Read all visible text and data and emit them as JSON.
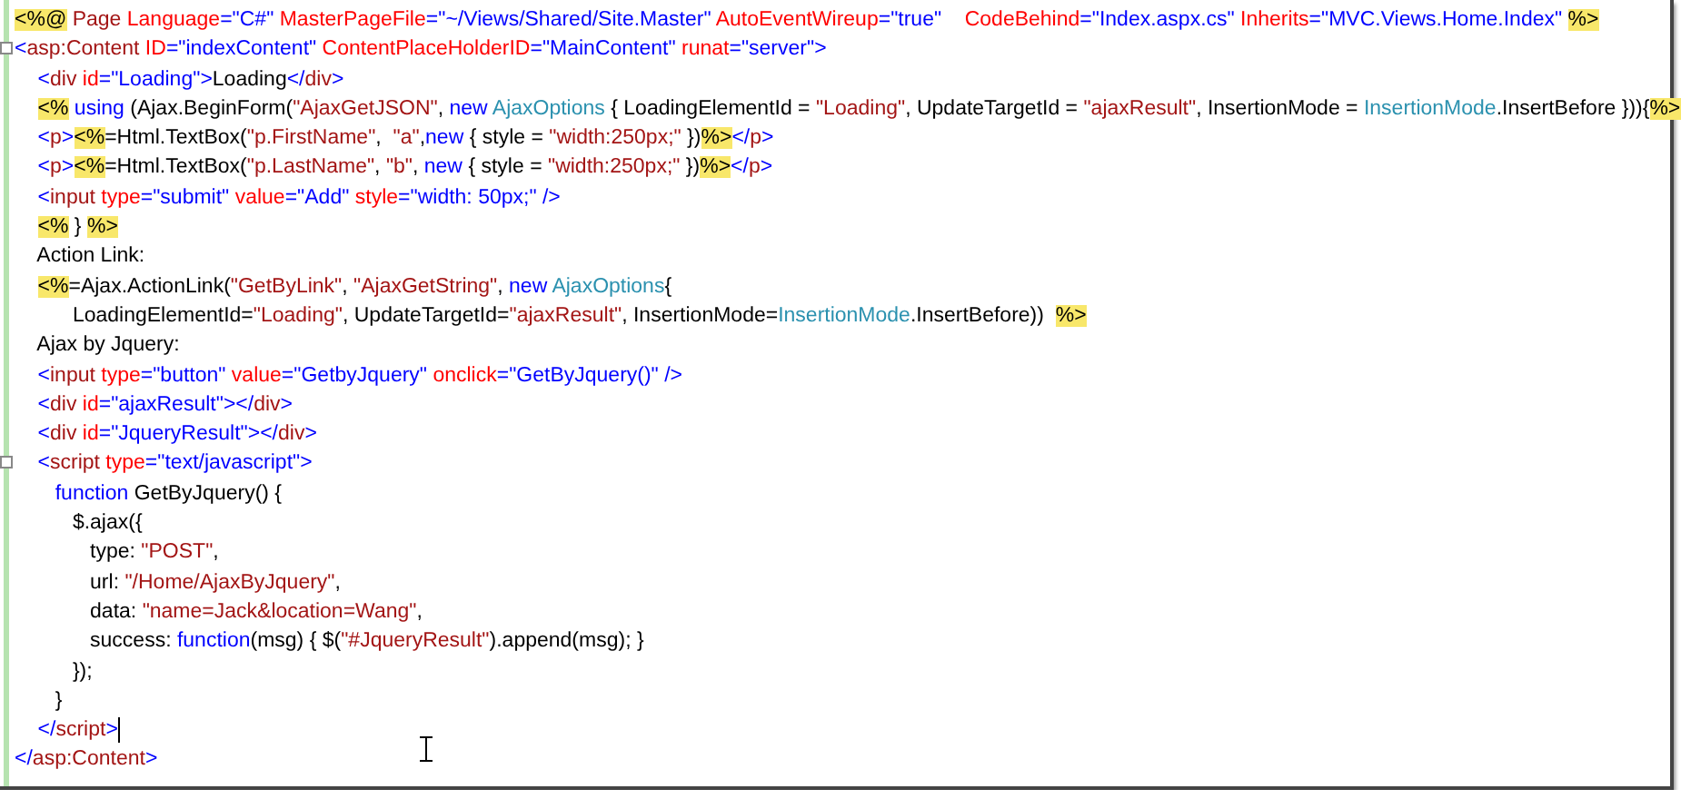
{
  "editor": {
    "lines": [
      {
        "collapsible": false,
        "caret": false,
        "tokens": [
          {
            "kind": "delim",
            "text": "<%@"
          },
          {
            "kind": "tag",
            "text": " Page"
          },
          {
            "kind": "attr",
            "text": " Language"
          },
          {
            "kind": "punct",
            "text": "="
          },
          {
            "kind": "value",
            "text": "\"C#\""
          },
          {
            "kind": "attr",
            "text": " MasterPageFile"
          },
          {
            "kind": "punct",
            "text": "="
          },
          {
            "kind": "value",
            "text": "\"~/Views/Shared/Site.Master\""
          },
          {
            "kind": "attr",
            "text": " AutoEventWireup"
          },
          {
            "kind": "punct",
            "text": "="
          },
          {
            "kind": "value",
            "text": "\"true\""
          },
          {
            "kind": "attr",
            "text": "    CodeBehind"
          },
          {
            "kind": "punct",
            "text": "="
          },
          {
            "kind": "value",
            "text": "\"Index.aspx.cs\""
          },
          {
            "kind": "attr",
            "text": " Inherits"
          },
          {
            "kind": "punct",
            "text": "="
          },
          {
            "kind": "value",
            "text": "\"MVC.Views.Home.Index\""
          },
          {
            "kind": "delim",
            "text": " %>"
          }
        ]
      },
      {
        "collapsible": true,
        "caret": false,
        "tokens": [
          {
            "kind": "punct",
            "text": "<"
          },
          {
            "kind": "tag",
            "text": "asp:Content"
          },
          {
            "kind": "attr",
            "text": " ID"
          },
          {
            "kind": "punct",
            "text": "="
          },
          {
            "kind": "value",
            "text": "\"indexContent\""
          },
          {
            "kind": "attr",
            "text": " ContentPlaceHolderID"
          },
          {
            "kind": "punct",
            "text": "="
          },
          {
            "kind": "value",
            "text": "\"MainContent\""
          },
          {
            "kind": "attr",
            "text": " runat"
          },
          {
            "kind": "punct",
            "text": "="
          },
          {
            "kind": "value",
            "text": "\"server\""
          },
          {
            "kind": "punct",
            "text": ">"
          }
        ]
      },
      {
        "collapsible": false,
        "caret": false,
        "tokens": [
          {
            "kind": "punct",
            "text": "    <"
          },
          {
            "kind": "tag",
            "text": "div"
          },
          {
            "kind": "attr",
            "text": " id"
          },
          {
            "kind": "punct",
            "text": "="
          },
          {
            "kind": "value",
            "text": "\"Loading\""
          },
          {
            "kind": "punct",
            "text": ">"
          },
          {
            "kind": "text",
            "text": "Loading"
          },
          {
            "kind": "punct",
            "text": "</"
          },
          {
            "kind": "tag",
            "text": "div"
          },
          {
            "kind": "punct",
            "text": ">"
          }
        ]
      },
      {
        "collapsible": false,
        "caret": false,
        "tokens": [
          {
            "kind": "delim",
            "text": "    <%"
          },
          {
            "kind": "keyword",
            "text": " using"
          },
          {
            "kind": "text",
            "text": " (Ajax.BeginForm("
          },
          {
            "kind": "string",
            "text": "\"AjaxGetJSON\""
          },
          {
            "kind": "text",
            "text": ", "
          },
          {
            "kind": "keyword",
            "text": "new"
          },
          {
            "kind": "type",
            "text": " AjaxOptions"
          },
          {
            "kind": "text",
            "text": " { LoadingElementId = "
          },
          {
            "kind": "string",
            "text": "\"Loading\""
          },
          {
            "kind": "text",
            "text": ", UpdateTargetId = "
          },
          {
            "kind": "string",
            "text": "\"ajaxResult\""
          },
          {
            "kind": "text",
            "text": ", InsertionMode = "
          },
          {
            "kind": "type",
            "text": "InsertionMode"
          },
          {
            "kind": "text",
            "text": ".InsertBefore })){"
          },
          {
            "kind": "delim",
            "text": "%>"
          }
        ]
      },
      {
        "collapsible": false,
        "caret": false,
        "tokens": [
          {
            "kind": "punct",
            "text": "    <"
          },
          {
            "kind": "tag",
            "text": "p"
          },
          {
            "kind": "punct",
            "text": ">"
          },
          {
            "kind": "delim",
            "text": "<%"
          },
          {
            "kind": "text",
            "text": "=Html.TextBox("
          },
          {
            "kind": "string",
            "text": "\"p.FirstName\""
          },
          {
            "kind": "text",
            "text": ",  "
          },
          {
            "kind": "string",
            "text": "\"a\""
          },
          {
            "kind": "text",
            "text": ","
          },
          {
            "kind": "keyword",
            "text": "new"
          },
          {
            "kind": "text",
            "text": " { style = "
          },
          {
            "kind": "string",
            "text": "\"width:250px;\""
          },
          {
            "kind": "text",
            "text": " })"
          },
          {
            "kind": "delim",
            "text": "%>"
          },
          {
            "kind": "punct",
            "text": "</"
          },
          {
            "kind": "tag",
            "text": "p"
          },
          {
            "kind": "punct",
            "text": ">"
          }
        ]
      },
      {
        "collapsible": false,
        "caret": false,
        "tokens": [
          {
            "kind": "punct",
            "text": "    <"
          },
          {
            "kind": "tag",
            "text": "p"
          },
          {
            "kind": "punct",
            "text": ">"
          },
          {
            "kind": "delim",
            "text": "<%"
          },
          {
            "kind": "text",
            "text": "=Html.TextBox("
          },
          {
            "kind": "string",
            "text": "\"p.LastName\""
          },
          {
            "kind": "text",
            "text": ", "
          },
          {
            "kind": "string",
            "text": "\"b\""
          },
          {
            "kind": "text",
            "text": ", "
          },
          {
            "kind": "keyword",
            "text": "new"
          },
          {
            "kind": "text",
            "text": " { style = "
          },
          {
            "kind": "string",
            "text": "\"width:250px;\""
          },
          {
            "kind": "text",
            "text": " })"
          },
          {
            "kind": "delim",
            "text": "%>"
          },
          {
            "kind": "punct",
            "text": "</"
          },
          {
            "kind": "tag",
            "text": "p"
          },
          {
            "kind": "punct",
            "text": ">"
          }
        ]
      },
      {
        "collapsible": false,
        "caret": false,
        "tokens": [
          {
            "kind": "punct",
            "text": "    <"
          },
          {
            "kind": "tag",
            "text": "input"
          },
          {
            "kind": "attr",
            "text": " type"
          },
          {
            "kind": "punct",
            "text": "="
          },
          {
            "kind": "value",
            "text": "\"submit\""
          },
          {
            "kind": "attr",
            "text": " value"
          },
          {
            "kind": "punct",
            "text": "="
          },
          {
            "kind": "value",
            "text": "\"Add\""
          },
          {
            "kind": "attr",
            "text": " style"
          },
          {
            "kind": "punct",
            "text": "="
          },
          {
            "kind": "value",
            "text": "\"width: 50px;\""
          },
          {
            "kind": "punct",
            "text": " />"
          }
        ]
      },
      {
        "collapsible": false,
        "caret": false,
        "tokens": [
          {
            "kind": "delim",
            "text": "    <%"
          },
          {
            "kind": "text",
            "text": " } "
          },
          {
            "kind": "delim",
            "text": "%>"
          }
        ]
      },
      {
        "collapsible": false,
        "caret": false,
        "tokens": [
          {
            "kind": "text",
            "text": "    Action Link:"
          }
        ]
      },
      {
        "collapsible": false,
        "caret": false,
        "tokens": [
          {
            "kind": "delim",
            "text": "    <%"
          },
          {
            "kind": "text",
            "text": "=Ajax.ActionLink("
          },
          {
            "kind": "string",
            "text": "\"GetByLink\""
          },
          {
            "kind": "text",
            "text": ", "
          },
          {
            "kind": "string",
            "text": "\"AjaxGetString\""
          },
          {
            "kind": "text",
            "text": ", "
          },
          {
            "kind": "keyword",
            "text": "new"
          },
          {
            "kind": "type",
            "text": " AjaxOptions"
          },
          {
            "kind": "text",
            "text": "{"
          }
        ]
      },
      {
        "collapsible": false,
        "caret": false,
        "tokens": [
          {
            "kind": "text",
            "text": "          LoadingElementId="
          },
          {
            "kind": "string",
            "text": "\"Loading\""
          },
          {
            "kind": "text",
            "text": ", UpdateTargetId="
          },
          {
            "kind": "string",
            "text": "\"ajaxResult\""
          },
          {
            "kind": "text",
            "text": ", InsertionMode="
          },
          {
            "kind": "type",
            "text": "InsertionMode"
          },
          {
            "kind": "text",
            "text": ".InsertBefore))  "
          },
          {
            "kind": "delim",
            "text": "%>"
          }
        ]
      },
      {
        "collapsible": false,
        "caret": false,
        "tokens": [
          {
            "kind": "text",
            "text": "    Ajax by Jquery:"
          }
        ]
      },
      {
        "collapsible": false,
        "caret": false,
        "tokens": [
          {
            "kind": "punct",
            "text": "    <"
          },
          {
            "kind": "tag",
            "text": "input"
          },
          {
            "kind": "attr",
            "text": " type"
          },
          {
            "kind": "punct",
            "text": "="
          },
          {
            "kind": "value",
            "text": "\"button\""
          },
          {
            "kind": "attr",
            "text": " value"
          },
          {
            "kind": "punct",
            "text": "="
          },
          {
            "kind": "value",
            "text": "\"GetbyJquery\""
          },
          {
            "kind": "attr",
            "text": " onclick"
          },
          {
            "kind": "punct",
            "text": "="
          },
          {
            "kind": "value",
            "text": "\"GetByJquery()\""
          },
          {
            "kind": "punct",
            "text": " />"
          }
        ]
      },
      {
        "collapsible": false,
        "caret": false,
        "tokens": [
          {
            "kind": "punct",
            "text": "    <"
          },
          {
            "kind": "tag",
            "text": "div"
          },
          {
            "kind": "attr",
            "text": " id"
          },
          {
            "kind": "punct",
            "text": "="
          },
          {
            "kind": "value",
            "text": "\"ajaxResult\""
          },
          {
            "kind": "punct",
            "text": "></"
          },
          {
            "kind": "tag",
            "text": "div"
          },
          {
            "kind": "punct",
            "text": ">"
          }
        ]
      },
      {
        "collapsible": false,
        "caret": false,
        "tokens": [
          {
            "kind": "punct",
            "text": "    <"
          },
          {
            "kind": "tag",
            "text": "div"
          },
          {
            "kind": "attr",
            "text": " id"
          },
          {
            "kind": "punct",
            "text": "="
          },
          {
            "kind": "value",
            "text": "\"JqueryResult\""
          },
          {
            "kind": "punct",
            "text": "></"
          },
          {
            "kind": "tag",
            "text": "div"
          },
          {
            "kind": "punct",
            "text": ">"
          }
        ]
      },
      {
        "collapsible": true,
        "caret": false,
        "tokens": [
          {
            "kind": "punct",
            "text": "    <"
          },
          {
            "kind": "tag",
            "text": "script"
          },
          {
            "kind": "attr",
            "text": " type"
          },
          {
            "kind": "punct",
            "text": "="
          },
          {
            "kind": "value",
            "text": "\"text/javascript\""
          },
          {
            "kind": "punct",
            "text": ">"
          }
        ]
      },
      {
        "collapsible": false,
        "caret": false,
        "tokens": [
          {
            "kind": "keyword",
            "text": "       function"
          },
          {
            "kind": "text",
            "text": " GetByJquery() {"
          }
        ]
      },
      {
        "collapsible": false,
        "caret": false,
        "tokens": [
          {
            "kind": "text",
            "text": "          $.ajax({"
          }
        ]
      },
      {
        "collapsible": false,
        "caret": false,
        "tokens": [
          {
            "kind": "text",
            "text": "             type: "
          },
          {
            "kind": "string",
            "text": "\"POST\""
          },
          {
            "kind": "text",
            "text": ","
          }
        ]
      },
      {
        "collapsible": false,
        "caret": false,
        "tokens": [
          {
            "kind": "text",
            "text": "             url: "
          },
          {
            "kind": "string",
            "text": "\"/Home/AjaxByJquery\""
          },
          {
            "kind": "text",
            "text": ","
          }
        ]
      },
      {
        "collapsible": false,
        "caret": false,
        "tokens": [
          {
            "kind": "text",
            "text": "             data: "
          },
          {
            "kind": "string",
            "text": "\"name=Jack&location=Wang\""
          },
          {
            "kind": "text",
            "text": ","
          }
        ]
      },
      {
        "collapsible": false,
        "caret": false,
        "tokens": [
          {
            "kind": "text",
            "text": "             success: "
          },
          {
            "kind": "keyword",
            "text": "function"
          },
          {
            "kind": "text",
            "text": "(msg) { $("
          },
          {
            "kind": "string",
            "text": "\"#JqueryResult\""
          },
          {
            "kind": "text",
            "text": ").append(msg); }"
          }
        ]
      },
      {
        "collapsible": false,
        "caret": false,
        "tokens": [
          {
            "kind": "text",
            "text": "          });"
          }
        ]
      },
      {
        "collapsible": false,
        "caret": false,
        "tokens": [
          {
            "kind": "text",
            "text": "       }"
          }
        ]
      },
      {
        "collapsible": false,
        "caret": true,
        "tokens": [
          {
            "kind": "punct",
            "text": "    </"
          },
          {
            "kind": "tag",
            "text": "script"
          },
          {
            "kind": "punct",
            "text": ">"
          }
        ]
      },
      {
        "collapsible": false,
        "caret": false,
        "tokens": [
          {
            "kind": "punct",
            "text": "</"
          },
          {
            "kind": "tag",
            "text": "asp:Content"
          },
          {
            "kind": "punct",
            "text": ">"
          }
        ]
      }
    ]
  }
}
